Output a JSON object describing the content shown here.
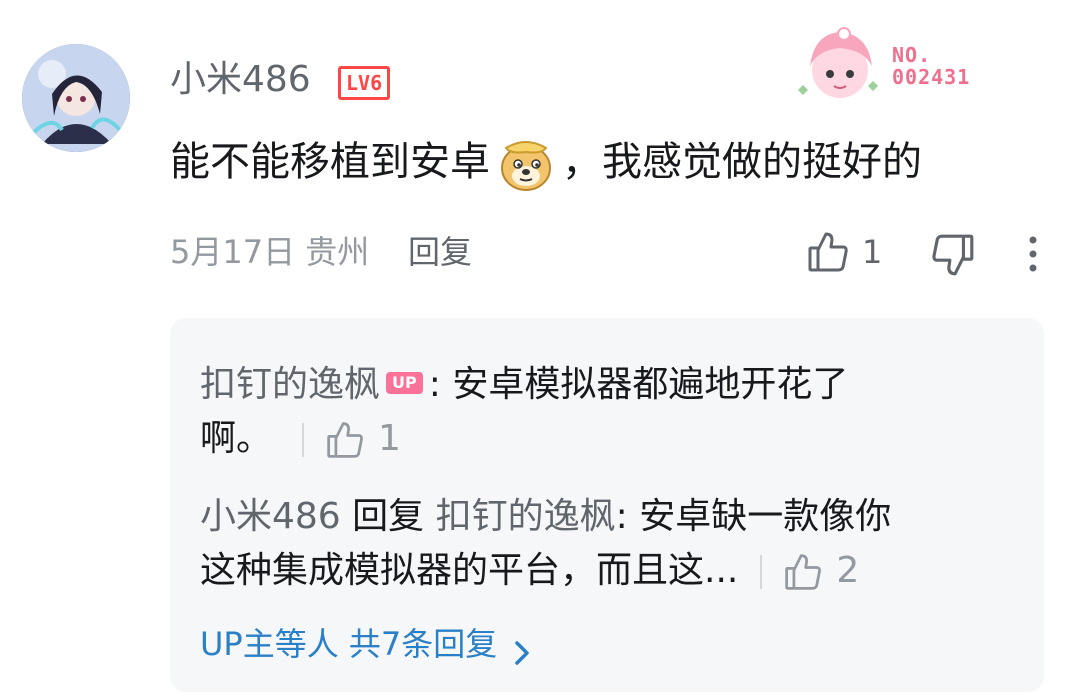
{
  "comment": {
    "username": "小米486",
    "level": "LV6",
    "fan_badge_no": "NO.",
    "fan_badge_id": "002431",
    "text_before": "能不能移植到安卓",
    "text_after": "，我感觉做的挺好的",
    "emoji": "doge-emoji",
    "date": "5月17日",
    "location": "贵州",
    "reply_label": "回复",
    "like_count": "1"
  },
  "replies": [
    {
      "author": "扣钉的逸枫",
      "badge": "UP",
      "colon": ":",
      "text_line1": " 安卓模拟器都遍地开花了",
      "text_line2": "啊。",
      "like_count": "1"
    },
    {
      "author": "小米486",
      "reply_word": "回复",
      "target": "扣钉的逸枫",
      "colon": ":",
      "text_line1": " 安卓缺一款像你",
      "text_line2": "这种集成模拟器的平台，而且这...",
      "like_count": "2"
    }
  ],
  "more_replies_text": "UP主等人 共7条回复",
  "icons": [
    "thumb-up-icon",
    "thumb-down-icon",
    "more-vertical-icon",
    "chevron-right-icon"
  ],
  "colors": {
    "accent_pink": "#fb7299",
    "level_red": "#ff4646",
    "link_blue": "#2a80c8",
    "reply_bg": "#f6f7f8"
  }
}
